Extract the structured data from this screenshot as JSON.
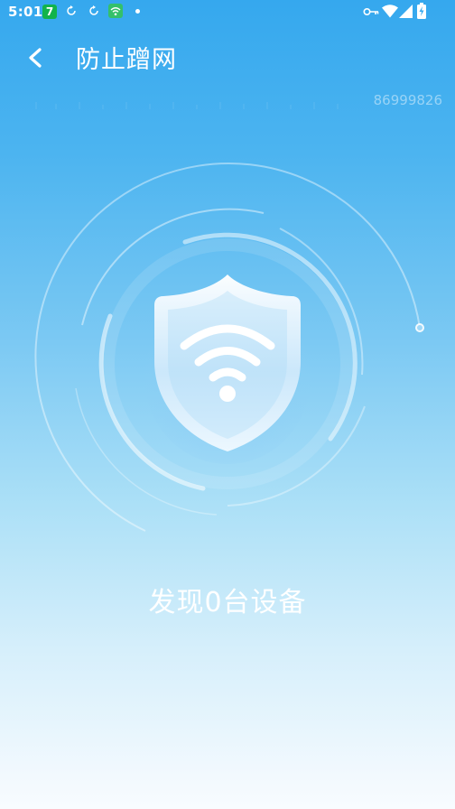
{
  "status_bar": {
    "time": "5:01",
    "app_badge": "7",
    "icons": [
      "sync-icon",
      "sync-icon",
      "wifi-app-icon",
      "notification-dot",
      "vpn-key-icon",
      "wifi-signal-icon",
      "cell-signal-icon",
      "battery-charging-icon"
    ]
  },
  "header": {
    "back_icon": "chevron-left-icon",
    "title": "防止蹭网"
  },
  "scan": {
    "id_number": "86999826",
    "center_icon": "shield-wifi-icon"
  },
  "result": {
    "text": "发现0台设备"
  },
  "colors": {
    "background_top": "#35a8ee",
    "background_bottom": "#f8fcff",
    "text": "#ffffff"
  }
}
